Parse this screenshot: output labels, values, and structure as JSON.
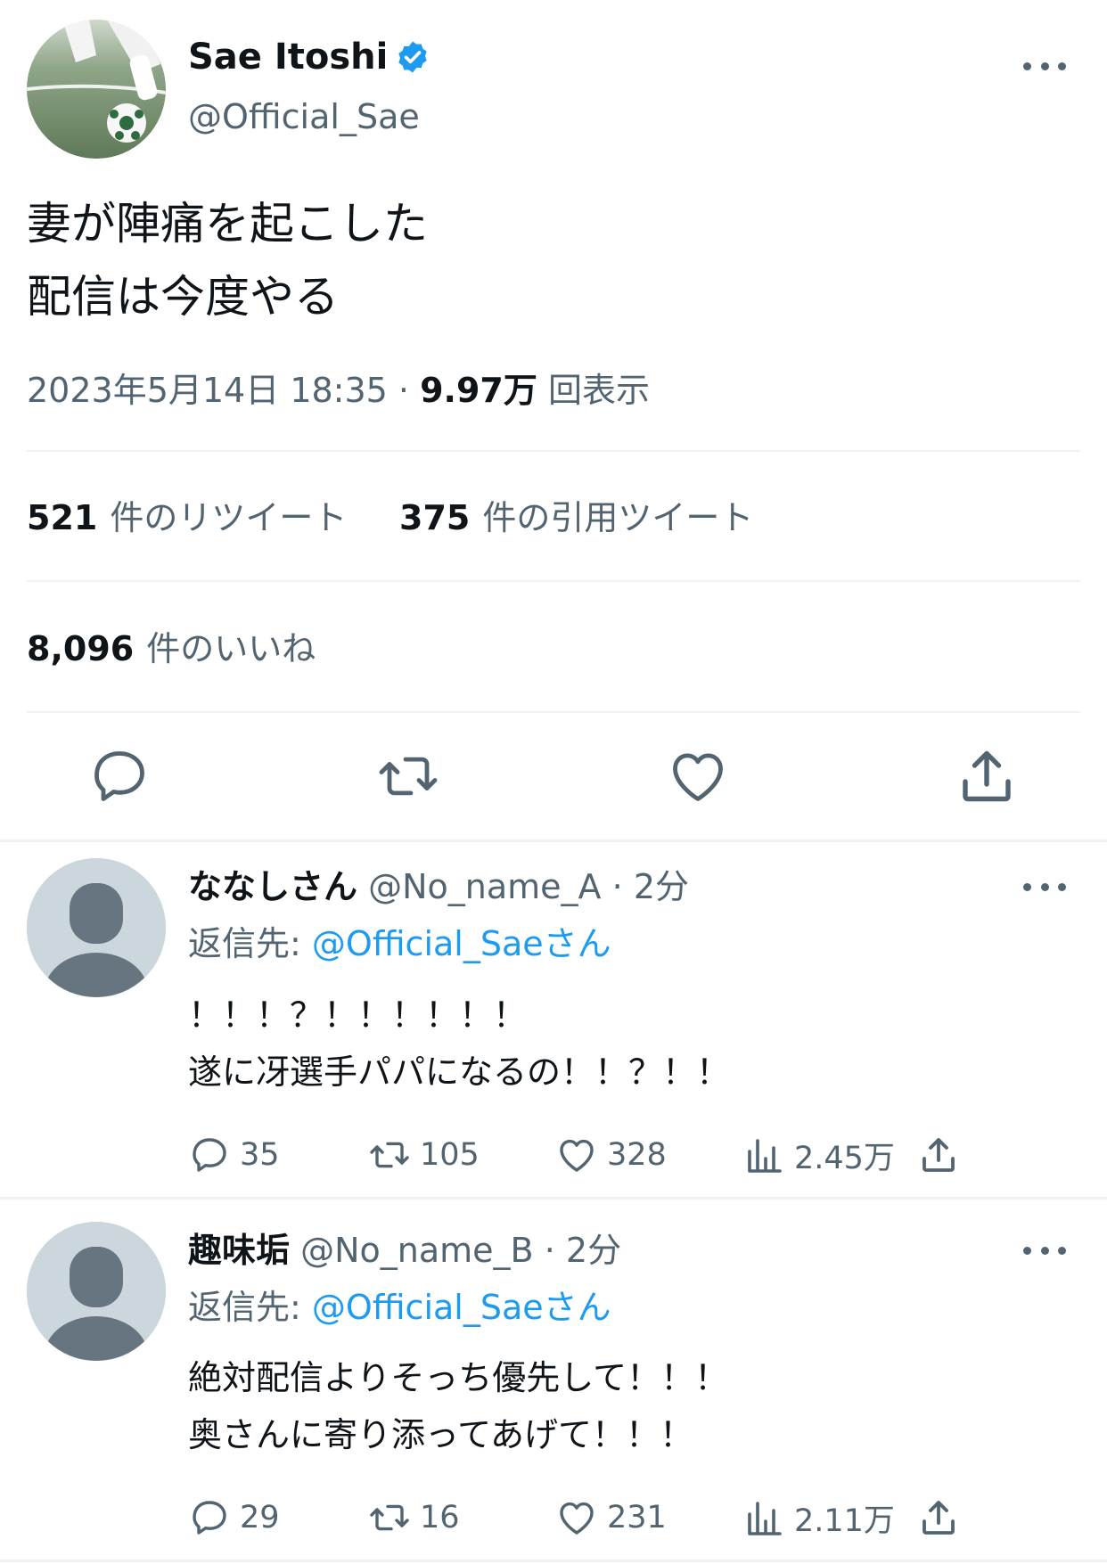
{
  "main_tweet": {
    "author_name": "Sae Itoshi",
    "handle": "@Official_Sae",
    "text_lines": [
      "妻が陣痛を起こした",
      "配信は今度やる"
    ],
    "timestamp": "2023年5月14日 18:35",
    "separator": "·",
    "views_count": "9.97万",
    "views_label": "回表示"
  },
  "stats": {
    "retweets_count": "521",
    "retweets_label": "件のリツイート",
    "quotes_count": "375",
    "quotes_label": "件の引用ツイート",
    "likes_count": "8,096",
    "likes_label": "件のいいね"
  },
  "actions": [
    "reply-icon",
    "retweet-icon",
    "like-icon",
    "share-icon"
  ],
  "replies": [
    {
      "name": "ななしさん",
      "handle": "@No_name_A",
      "sep": "·",
      "time": "2分",
      "reply_to_label": "返信先:",
      "reply_to_mention": "@Official_Saeさん",
      "text_lines": [
        "！！！？！！！！！！",
        "遂に冴選手パパになるの！！？！！"
      ],
      "reply_count": "35",
      "retweet_count": "105",
      "like_count": "328",
      "views": "2.45万"
    },
    {
      "name": "趣味垢",
      "handle": "@No_name_B",
      "sep": "·",
      "time": "2分",
      "reply_to_label": "返信先:",
      "reply_to_mention": "@Official_Saeさん",
      "text_lines": [
        "絶対配信よりそっち優先して！！！",
        "奥さんに寄り添ってあげて！！！"
      ],
      "reply_count": "29",
      "retweet_count": "16",
      "like_count": "231",
      "views": "2.11万"
    }
  ],
  "colors": {
    "accent": "#1d9bf0",
    "secondary_text": "#536471",
    "divider": "#eff3f4",
    "avatar_placeholder": "#ccd6dd",
    "avatar_figure": "#66757f"
  }
}
